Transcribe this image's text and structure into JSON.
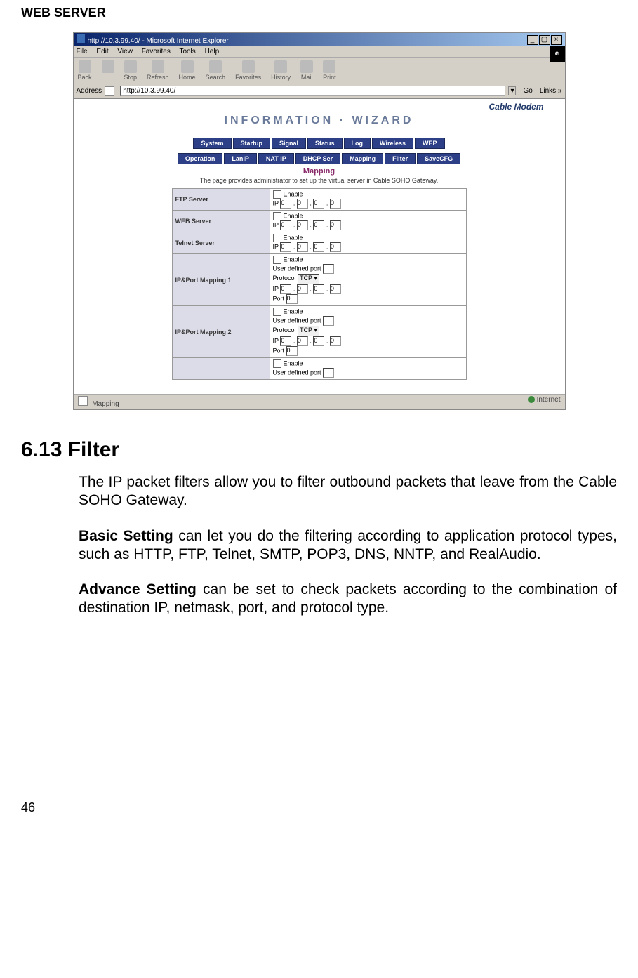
{
  "header": "WEB SERVER",
  "page_number": "46",
  "section": {
    "heading": "6.13 Filter",
    "p1": "The IP packet filters allow you to filter outbound packets that leave from the Cable SOHO Gateway.",
    "p2_label": "Basic Setting",
    "p2_rest": " can let you do the filtering according to application protocol types, such as HTTP, FTP, Telnet, SMTP, POP3, DNS, NNTP, and RealAudio.",
    "p3_label": "Advance Setting",
    "p3_rest": " can be set to check packets according to the combination of destination IP, netmask, port, and protocol type."
  },
  "screenshot": {
    "window_title": "http://10.3.99.40/ - Microsoft Internet Explorer",
    "menubar": [
      "File",
      "Edit",
      "View",
      "Favorites",
      "Tools",
      "Help"
    ],
    "toolbar": [
      "Back",
      "",
      "",
      "Stop",
      "Refresh",
      "Home",
      "Search",
      "Favorites",
      "History",
      "Mail",
      "Print"
    ],
    "address_label": "Address",
    "address_value": "http://10.3.99.40/",
    "go_label": "Go",
    "links_label": "Links »",
    "brand": "Cable Modem",
    "info_wizard": "INFORMATION · WIZARD",
    "nav1": [
      "System",
      "Startup",
      "Signal",
      "Status",
      "Log",
      "Wireless",
      "WEP"
    ],
    "nav2": [
      "Operation",
      "LanIP",
      "NAT IP",
      "DHCP Ser",
      "Mapping",
      "Filter",
      "SaveCFG"
    ],
    "section_title": "Mapping",
    "section_desc": "The page provides administrator to set up the virtual server in Cable SOHO Gateway.",
    "rows": {
      "ftp": {
        "label": "FTP Server",
        "enable": "Enable",
        "ip_prefix": "IP",
        "octets": [
          "0",
          "0",
          "0",
          "0"
        ]
      },
      "web": {
        "label": "WEB Server",
        "enable": "Enable",
        "ip_prefix": "IP",
        "octets": [
          "0",
          "0",
          "0",
          "0"
        ]
      },
      "telnet": {
        "label": "Telnet Server",
        "enable": "Enable",
        "ip_prefix": "IP",
        "octets": [
          "0",
          "0",
          "0",
          "0"
        ]
      },
      "map1": {
        "label": "IP&Port Mapping 1",
        "enable": "Enable",
        "udp_label": "User defined port",
        "proto_label": "Protocol",
        "proto_value": "TCP",
        "ip_prefix": "IP",
        "octets": [
          "0",
          "0",
          "0",
          "0"
        ],
        "port_label": "Port",
        "port_value": "0"
      },
      "map2": {
        "label": "IP&Port Mapping 2",
        "enable": "Enable",
        "udp_label": "User defined port",
        "proto_label": "Protocol",
        "proto_value": "TCP",
        "ip_prefix": "IP",
        "octets": [
          "0",
          "0",
          "0",
          "0"
        ],
        "port_label": "Port",
        "port_value": "0"
      },
      "map3": {
        "enable": "Enable",
        "udp_label": "User defined port"
      }
    },
    "status_left": "Mapping",
    "status_right": "Internet"
  }
}
